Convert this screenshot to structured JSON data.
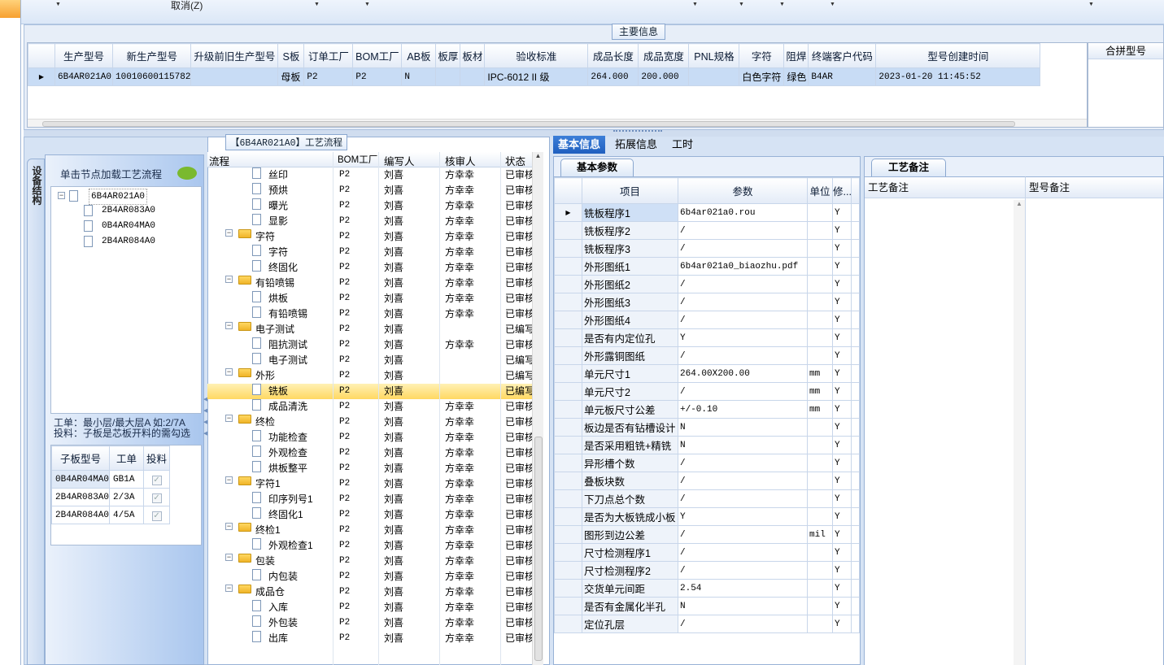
{
  "toolbar": {
    "cancel_label": "取消(Z)"
  },
  "main_info": {
    "title": "主要信息",
    "merge_header": "合拼型号",
    "columns": [
      "生产型号",
      "新生产型号",
      "升级前旧生产型号",
      "S板",
      "订单工厂",
      "BOM工厂",
      "AB板",
      "板厚",
      "板材",
      "验收标准",
      "成品长度",
      "成品宽度",
      "PNL规格",
      "字符",
      "阻焊",
      "终端客户代码",
      "型号创建时间"
    ],
    "row": [
      "6B4AR021A0",
      "10010600115782",
      "",
      "母板",
      "P2",
      "P2",
      "N",
      "",
      "",
      "IPC-6012 II 级",
      "264.000",
      "200.000",
      "",
      "白色字符",
      "绿色",
      "B4AR",
      "2023-01-20 11:45:52"
    ]
  },
  "left_panel": {
    "vertical_tab": "设备结构",
    "hint": "单击节点加载工艺流程",
    "tree_root": "6B4AR021A0",
    "tree_children": [
      "2B4AR083A0",
      "0B4AR04MA0",
      "2B4AR084A0"
    ],
    "note_line1": "工单：最小层/最大层A 如:2/7A",
    "note_line2": "投料：子板是芯板开料的需勾选",
    "sub_headers": [
      "子板型号",
      "工单",
      "投料"
    ],
    "sub_rows": [
      [
        "0B4AR04MA0",
        "GB1A"
      ],
      [
        "2B4AR083A0",
        "2/3A"
      ],
      [
        "2B4AR084A0",
        "4/5A"
      ]
    ]
  },
  "process": {
    "title": "【6B4AR021A0】工艺流程",
    "headers": [
      "流程",
      "BOM工厂",
      "编写人",
      "核审人",
      "状态"
    ],
    "rows": [
      {
        "name": "丝印",
        "level": 2,
        "bom": "P2",
        "author": "刘喜",
        "reviewer": "方幸幸",
        "status": "已审核"
      },
      {
        "name": "预烘",
        "level": 2,
        "bom": "P2",
        "author": "刘喜",
        "reviewer": "方幸幸",
        "status": "已审核"
      },
      {
        "name": "曝光",
        "level": 2,
        "bom": "P2",
        "author": "刘喜",
        "reviewer": "方幸幸",
        "status": "已审核"
      },
      {
        "name": "显影",
        "level": 2,
        "bom": "P2",
        "author": "刘喜",
        "reviewer": "方幸幸",
        "status": "已审核"
      },
      {
        "name": "字符",
        "level": 1,
        "bom": "P2",
        "author": "刘喜",
        "reviewer": "方幸幸",
        "status": "已审核"
      },
      {
        "name": "字符",
        "level": 2,
        "bom": "P2",
        "author": "刘喜",
        "reviewer": "方幸幸",
        "status": "已审核"
      },
      {
        "name": "终固化",
        "level": 2,
        "bom": "P2",
        "author": "刘喜",
        "reviewer": "方幸幸",
        "status": "已审核"
      },
      {
        "name": "有铅喷锡",
        "level": 1,
        "bom": "P2",
        "author": "刘喜",
        "reviewer": "方幸幸",
        "status": "已审核"
      },
      {
        "name": "烘板",
        "level": 2,
        "bom": "P2",
        "author": "刘喜",
        "reviewer": "方幸幸",
        "status": "已审核"
      },
      {
        "name": "有铅喷锡",
        "level": 2,
        "bom": "P2",
        "author": "刘喜",
        "reviewer": "方幸幸",
        "status": "已审核"
      },
      {
        "name": "电子测试",
        "level": 1,
        "bom": "P2",
        "author": "刘喜",
        "reviewer": "",
        "status": "已编写"
      },
      {
        "name": "阻抗测试",
        "level": 2,
        "bom": "P2",
        "author": "刘喜",
        "reviewer": "方幸幸",
        "status": "已审核"
      },
      {
        "name": "电子测试",
        "level": 2,
        "bom": "P2",
        "author": "刘喜",
        "reviewer": "",
        "status": "已编写"
      },
      {
        "name": "外形",
        "level": 1,
        "bom": "P2",
        "author": "刘喜",
        "reviewer": "",
        "status": "已编写"
      },
      {
        "name": "铣板",
        "level": 2,
        "bom": "P2",
        "author": "刘喜",
        "reviewer": "",
        "status": "已编写",
        "selected": true
      },
      {
        "name": "成品清洗",
        "level": 2,
        "bom": "P2",
        "author": "刘喜",
        "reviewer": "方幸幸",
        "status": "已审核"
      },
      {
        "name": "终检",
        "level": 1,
        "bom": "P2",
        "author": "刘喜",
        "reviewer": "方幸幸",
        "status": "已审核"
      },
      {
        "name": "功能检查",
        "level": 2,
        "bom": "P2",
        "author": "刘喜",
        "reviewer": "方幸幸",
        "status": "已审核"
      },
      {
        "name": "外观检查",
        "level": 2,
        "bom": "P2",
        "author": "刘喜",
        "reviewer": "方幸幸",
        "status": "已审核"
      },
      {
        "name": "烘板整平",
        "level": 2,
        "bom": "P2",
        "author": "刘喜",
        "reviewer": "方幸幸",
        "status": "已审核"
      },
      {
        "name": "字符1",
        "level": 1,
        "bom": "P2",
        "author": "刘喜",
        "reviewer": "方幸幸",
        "status": "已审核"
      },
      {
        "name": "印序列号1",
        "level": 2,
        "bom": "P2",
        "author": "刘喜",
        "reviewer": "方幸幸",
        "status": "已审核"
      },
      {
        "name": "终固化1",
        "level": 2,
        "bom": "P2",
        "author": "刘喜",
        "reviewer": "方幸幸",
        "status": "已审核"
      },
      {
        "name": "终检1",
        "level": 1,
        "bom": "P2",
        "author": "刘喜",
        "reviewer": "方幸幸",
        "status": "已审核"
      },
      {
        "name": "外观检查1",
        "level": 2,
        "bom": "P2",
        "author": "刘喜",
        "reviewer": "方幸幸",
        "status": "已审核"
      },
      {
        "name": "包装",
        "level": 1,
        "bom": "P2",
        "author": "刘喜",
        "reviewer": "方幸幸",
        "status": "已审核"
      },
      {
        "name": "内包装",
        "level": 2,
        "bom": "P2",
        "author": "刘喜",
        "reviewer": "方幸幸",
        "status": "已审核"
      },
      {
        "name": "成品仓",
        "level": 1,
        "bom": "P2",
        "author": "刘喜",
        "reviewer": "方幸幸",
        "status": "已审核"
      },
      {
        "name": "入库",
        "level": 2,
        "bom": "P2",
        "author": "刘喜",
        "reviewer": "方幸幸",
        "status": "已审核"
      },
      {
        "name": "外包装",
        "level": 2,
        "bom": "P2",
        "author": "刘喜",
        "reviewer": "方幸幸",
        "status": "已审核"
      },
      {
        "name": "出库",
        "level": 2,
        "bom": "P2",
        "author": "刘喜",
        "reviewer": "方幸幸",
        "status": "已审核"
      }
    ]
  },
  "right_tabs": [
    "基本信息",
    "拓展信息",
    "工时"
  ],
  "basic_params": {
    "tab": "基本参数",
    "headers": [
      "项目",
      "参数",
      "单位",
      "修..."
    ],
    "rows": [
      [
        "铣板程序1",
        "6b4ar021a0.rou",
        "",
        "Y"
      ],
      [
        "铣板程序2",
        "/",
        "",
        "Y"
      ],
      [
        "铣板程序3",
        "/",
        "",
        "Y"
      ],
      [
        "外形图纸1",
        "6b4ar021a0_biaozhu.pdf",
        "",
        "Y"
      ],
      [
        "外形图纸2",
        "/",
        "",
        "Y"
      ],
      [
        "外形图纸3",
        "/",
        "",
        "Y"
      ],
      [
        "外形图纸4",
        "/",
        "",
        "Y"
      ],
      [
        "是否有内定位孔",
        "Y",
        "",
        "Y"
      ],
      [
        "外形露铜图纸",
        "/",
        "",
        "Y"
      ],
      [
        "单元尺寸1",
        "264.00X200.00",
        "mm",
        "Y"
      ],
      [
        "单元尺寸2",
        "/",
        "mm",
        "Y"
      ],
      [
        "单元板尺寸公差",
        "+/-0.10",
        "mm",
        "Y"
      ],
      [
        "板边是否有钻槽设计",
        "N",
        "",
        "Y"
      ],
      [
        "是否采用粗铣+精铣",
        "N",
        "",
        "Y"
      ],
      [
        "异形槽个数",
        "/",
        "",
        "Y"
      ],
      [
        "叠板块数",
        "/",
        "",
        "Y"
      ],
      [
        "下刀点总个数",
        "/",
        "",
        "Y"
      ],
      [
        "是否为大板铣成小板",
        "Y",
        "",
        "Y"
      ],
      [
        "图形到边公差",
        "/",
        "mil",
        "Y"
      ],
      [
        "尺寸检测程序1",
        "/",
        "",
        "Y"
      ],
      [
        "尺寸检测程序2",
        "/",
        "",
        "Y"
      ],
      [
        "交货单元间距",
        "2.54",
        "",
        "Y"
      ],
      [
        "是否有金属化半孔",
        "N",
        "",
        "Y"
      ],
      [
        "定位孔层",
        "/",
        "",
        "Y"
      ]
    ]
  },
  "process_notes": {
    "tab": "工艺备注",
    "headers": [
      "工艺备注",
      "型号备注"
    ]
  }
}
